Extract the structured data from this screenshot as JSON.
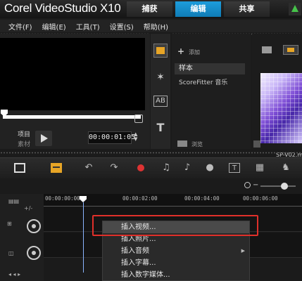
{
  "app": {
    "logo": "Corel VideoStudio X10"
  },
  "tabs": [
    {
      "label": "捕获",
      "active": false
    },
    {
      "label": "编辑",
      "active": true
    },
    {
      "label": "共享",
      "active": false
    }
  ],
  "menu": [
    "文件(F)",
    "编辑(E)",
    "工具(T)",
    "设置(S)",
    "帮助(H)"
  ],
  "player": {
    "mode_project": "项目",
    "mode_clip": "素材",
    "timecode": "00:00:01:05",
    "scrub_progress": 0
  },
  "library": {
    "add_label": "添加",
    "folders": [
      "样本",
      "ScoreFitter 音乐"
    ],
    "browse_label": "浏览",
    "thumb_caption": "SP-V02.m..."
  },
  "timeline": {
    "ticks": [
      "00:00:00:00",
      "00:00:02:00",
      "00:00:04:00",
      "00:00:06:00"
    ]
  },
  "context_menu": {
    "items": [
      {
        "label": "插入视频...",
        "highlighted": true
      },
      {
        "label": "插入照片...",
        "highlighted": false
      },
      {
        "label": "插入音频",
        "submenu": true
      },
      {
        "label": "插入字幕...",
        "highlighted": false
      },
      {
        "label": "插入数字媒体...",
        "highlighted": false
      }
    ]
  },
  "colors": {
    "accent": "#1b94d4",
    "highlight_box": "#e0302a",
    "folder_icon": "#e7a526"
  }
}
